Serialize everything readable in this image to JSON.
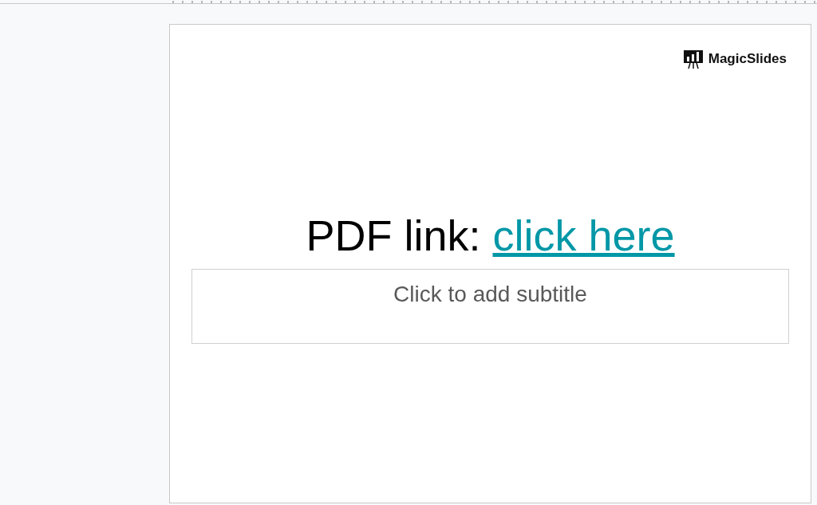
{
  "logo": {
    "text": "MagicSlides"
  },
  "title": {
    "prefix": "PDF link: ",
    "link": "click here"
  },
  "subtitle": {
    "placeholder": "Click to add subtitle"
  }
}
